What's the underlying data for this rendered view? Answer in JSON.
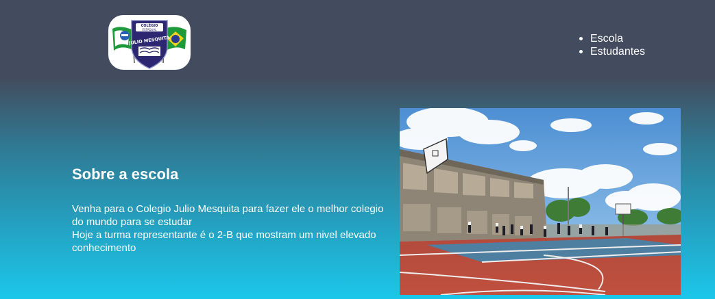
{
  "header": {
    "logo": {
      "top_text": "COLÉGIO",
      "sub_text": "ESTADUAL",
      "name_text": "JULIO MESQUITA",
      "colors": {
        "shield": "#2c2770",
        "green": "#1f9a3a",
        "yellow": "#f0d21b",
        "blue": "#2b3a93"
      }
    },
    "nav": {
      "items": [
        {
          "label": "Escola"
        },
        {
          "label": "Estudantes"
        }
      ]
    }
  },
  "about": {
    "title": "Sobre a escola",
    "line1": "Venha para o Colegio Julio Mesquita para fazer ele o melhor colegio do mundo para se estudar",
    "line2": "Hoje a turma representante é o 2-B que mostram um nivel elevado conhecimento"
  },
  "photo": {
    "subject": "outdoor-basketball-court"
  },
  "colors": {
    "header_bg": "#434c5e",
    "gradient_bottom": "#1cc7ea",
    "text": "#ffffff"
  }
}
